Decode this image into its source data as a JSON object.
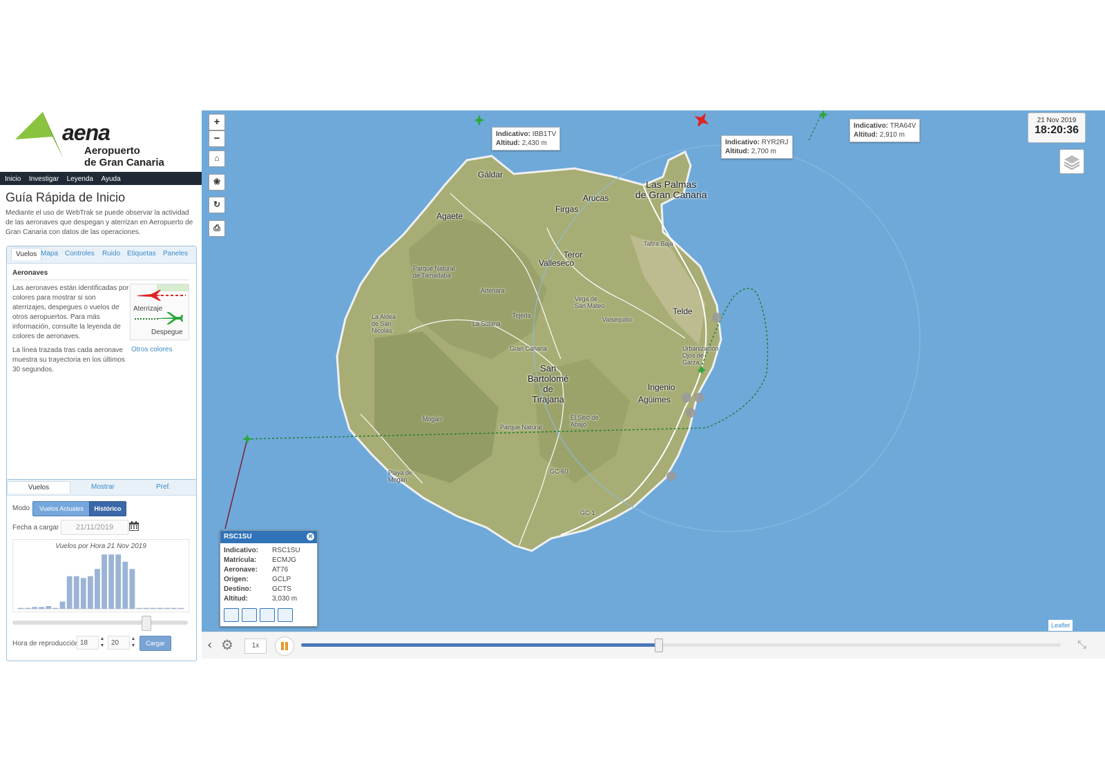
{
  "logo": {
    "wordmark": "aena",
    "line1": "Aeropuerto",
    "line2": "de Gran Canaria"
  },
  "nav": [
    "Inicio",
    "Investigar",
    "Leyenda",
    "Ayuda"
  ],
  "guide": {
    "title": "Guía Rápida de Inicio",
    "text": "Mediante el uso de WebTrak se puede observar la actividad de las aeronaves que despegan y aterrizan en Aeropuerto de Gran Canaria con datos de las operaciones."
  },
  "panel1": {
    "tabs": [
      "Vuelos",
      "Mapa",
      "Controles",
      "Ruido",
      "Etiquetas",
      "Paneles"
    ],
    "heading": "Aeronaves",
    "text1": "Las aeronaves están identificadas por colores para mostrar si son aterrizajes, despegues o vuelos de otros aeropuertos. Para más información, consulte la leyenda de colores de aeronaves.",
    "text2": "La línea trazada tras cada aeronave muestra su trayectoria en los últimos 30 segundos.",
    "legend_arrival": "Aterrizaje",
    "legend_departure": "Despegue",
    "otros_link": "Otros colores",
    "colors": {
      "arrival": "#e02424",
      "departure": "#2aa83a"
    }
  },
  "panel2": {
    "tabs": [
      "Vuelos",
      "Mostrar",
      "Pref."
    ],
    "modo_label": "Modo",
    "btn_actuales": "Vuelos Actuales",
    "btn_historico": "Histórico",
    "fecha_label": "Fecha a cargar",
    "fecha_value": "21/11/2019",
    "hora_label": "Hora de reproducción",
    "hora_h": "18",
    "hora_m": "20",
    "cargar": "Cargar",
    "slider_fraction": 0.76
  },
  "chart_data": {
    "type": "bar",
    "title": "Vuelos por Hora 21 Nov 2019",
    "categories": [
      "0",
      "1",
      "2",
      "3",
      "4",
      "5",
      "6",
      "7",
      "8",
      "9",
      "10",
      "11",
      "12",
      "13",
      "14",
      "15",
      "16",
      "17",
      "18",
      "19",
      "20",
      "21",
      "22",
      "23"
    ],
    "values": [
      0.5,
      0.5,
      1,
      1,
      1.5,
      0.5,
      4,
      18,
      18,
      17,
      18,
      22,
      30,
      30,
      30,
      26,
      22,
      0.5,
      0.5,
      0.5,
      0.5,
      0.5,
      0.5,
      0.5
    ],
    "ylim": [
      0,
      32
    ]
  },
  "map": {
    "zoom_in": "+",
    "zoom_out": "−",
    "clock_date": "21 Nov 2019",
    "clock_time": "18:20:36",
    "labels": [
      {
        "id": "IBB1TV",
        "k1": "Indicativo:",
        "v1": "IBB1TV",
        "k2": "Altitud:",
        "v2": "2,430 m"
      },
      {
        "id": "RYR2RJ",
        "k1": "Indicativo:",
        "v1": "RYR2RJ",
        "k2": "Altitud:",
        "v2": "2,700 m"
      },
      {
        "id": "TRA64V",
        "k1": "Indicativo:",
        "v1": "TRA64V",
        "k2": "Altitud:",
        "v2": "2,910 m"
      }
    ],
    "places": {
      "galdar": "Gáldar",
      "laspalmas1": "Las Palmas",
      "laspalmas2": "de Gran Canaria",
      "arucas": "Arucas",
      "firgas": "Firgas",
      "agaete": "Agaete",
      "tafira": "Tafira Baja",
      "teror": "Teror",
      "valleseco": "Valleseco",
      "tamadaba1": "Parque Natural",
      "tamadaba2": "de Tamadaba",
      "artenara": "Artenara",
      "vega1": "Vega de",
      "vega2": "San Mateo",
      "telde": "Telde",
      "aldea1": "La Aldea",
      "aldea2": "de San",
      "aldea3": "Nicolás",
      "tejeda": "Tejeda",
      "valsequillo": "Valsequillo",
      "solana": "La Solana",
      "grancanaria": "Gran Canaria",
      "urb1": "Urbanización",
      "urb2": "Ojos de",
      "urb3": "Garza",
      "sb1": "San",
      "sb2": "Bartolomé",
      "sb3": "de",
      "sb4": "Tirajana",
      "ingenio": "Ingenio",
      "aguimes": "Agüimes",
      "mogan": "Mogán",
      "sitio1": "El Sitio de",
      "sitio2": "Abajo",
      "pnat": "Parque Natural",
      "gc60": "GC-60",
      "playa1": "Playa de",
      "playa2": "Mogán",
      "gc1": "GC-1"
    },
    "popup": {
      "title": "RSC1SU",
      "rows": [
        {
          "k": "Indicativo:",
          "v": "RSC1SU"
        },
        {
          "k": "Matrícula:",
          "v": "ECMJG"
        },
        {
          "k": "Aeronave:",
          "v": "AT76"
        },
        {
          "k": "Origen:",
          "v": "GCLP"
        },
        {
          "k": "Destino:",
          "v": "GCTS"
        },
        {
          "k": "Altitud:",
          "v": "3,030 m"
        }
      ]
    },
    "attribution": "Leaflet",
    "colors": {
      "sea": "#6ea9d9",
      "land": "#a7ad74",
      "track": "#2aa83a"
    }
  },
  "playback": {
    "speed": "1x",
    "progress_fraction": 0.47
  }
}
